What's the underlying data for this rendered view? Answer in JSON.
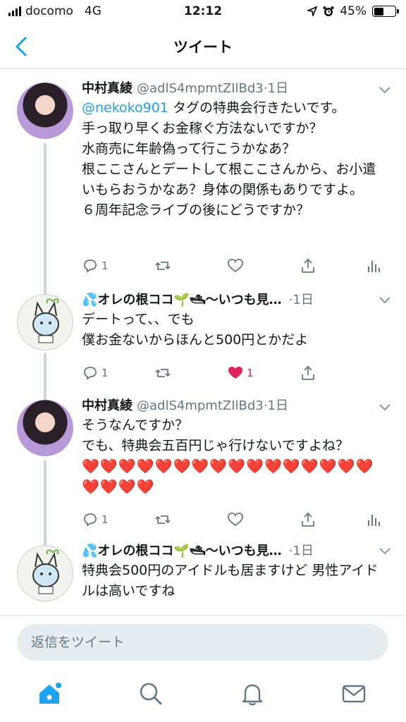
{
  "status_bar": {
    "carrier": "docomo",
    "network": "4G",
    "time": "12:12",
    "battery": "45%",
    "battery_level": 0.45
  },
  "nav": {
    "title": "ツイート"
  },
  "tweets": [
    {
      "display_name": "中村真綾",
      "handle": "@adlS4mpmtZIlBd3",
      "dot": "·",
      "time": "1日",
      "mention": "@nekoko901",
      "text_after_mention": " タグの特典会行きたいです。\n手っ取り早くお金稼ぐ方法ないですか？\n水商売に年齢偽って行こうかなあ？\n根ここさんとデートして根ここさんから、お小遣いもらおうかなあ？身体の関係もありですよ。\n６周年記念ライブの後にどうですか？",
      "reply_count": "1",
      "like_count": ""
    },
    {
      "display_name": "💦オレの根ココ🌱🛥〜いつも見…",
      "dot": "·",
      "time": "1日",
      "text": "デートって、、でも\n僕お金ないからほんと500円とかだよ",
      "reply_count": "1",
      "like_count": "1"
    },
    {
      "display_name": "中村真綾",
      "handle": "@adlS4mpmtZIlBd3",
      "dot": "·",
      "time": "1日",
      "text": "そうなんですか？\nでも、特典会五百円じゃ行けないですよね？",
      "hearts": "❤️❤️❤️❤️❤️❤️❤️❤️❤️❤️❤️❤️❤️❤️❤️❤️❤️❤️❤️❤️",
      "reply_count": "1",
      "like_count": ""
    },
    {
      "display_name": "💦オレの根ココ🌱🛥〜いつも見…",
      "dot": "·",
      "time": "1日",
      "text": "特典会500円のアイドルも居ますけど 男性アイドルは高いですね"
    }
  ],
  "reply_bar": {
    "placeholder": "返信をツイート"
  },
  "tab_bar": {
    "items": [
      "home-icon",
      "search-icon",
      "bell-icon",
      "mail-icon"
    ]
  },
  "colors": {
    "accent": "#1da1f2",
    "like": "#e0245e",
    "secondary_text": "#657786"
  }
}
